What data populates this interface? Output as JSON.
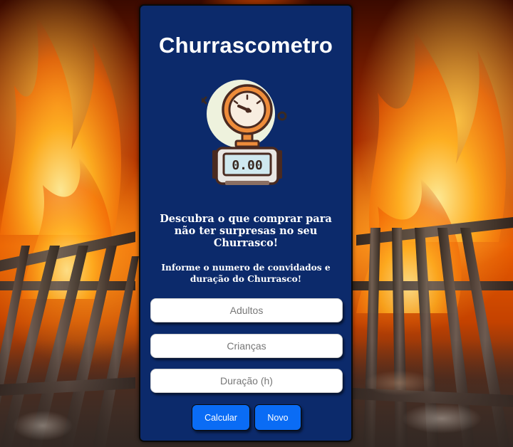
{
  "app": {
    "title": "Churrascometro",
    "tagline": "Descubra o que comprar para não ter surpresas no seu Churrasco!",
    "instructions": "Informe o numero de convidados e duração do Churrasco!"
  },
  "logo": {
    "icon": "pressure-gauge-scale-icon",
    "display_value": "0.00"
  },
  "form": {
    "adults_placeholder": "Adultos",
    "children_placeholder": "Crianças",
    "duration_placeholder": "Duração (h)"
  },
  "buttons": {
    "calculate_label": "Calcular",
    "new_label": "Novo"
  },
  "colors": {
    "card_background": "#0c2a6b",
    "button_primary": "#0a6cf5",
    "text": "#ffffff"
  }
}
